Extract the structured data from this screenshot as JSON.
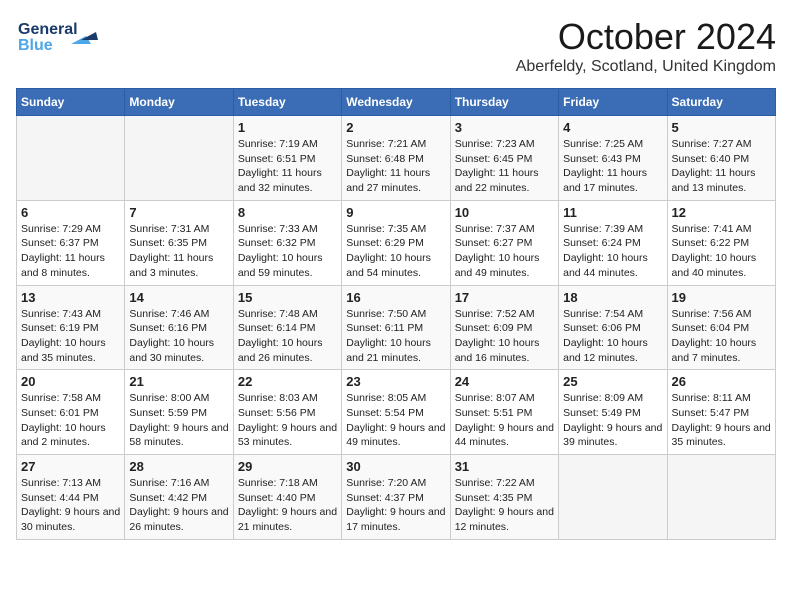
{
  "logo": {
    "line1": "General",
    "line2": "Blue"
  },
  "title": {
    "month": "October 2024",
    "location": "Aberfeldy, Scotland, United Kingdom"
  },
  "headers": [
    "Sunday",
    "Monday",
    "Tuesday",
    "Wednesday",
    "Thursday",
    "Friday",
    "Saturday"
  ],
  "weeks": [
    [
      {
        "day": "",
        "info": ""
      },
      {
        "day": "",
        "info": ""
      },
      {
        "day": "1",
        "info": "Sunrise: 7:19 AM\nSunset: 6:51 PM\nDaylight: 11 hours and 32 minutes."
      },
      {
        "day": "2",
        "info": "Sunrise: 7:21 AM\nSunset: 6:48 PM\nDaylight: 11 hours and 27 minutes."
      },
      {
        "day": "3",
        "info": "Sunrise: 7:23 AM\nSunset: 6:45 PM\nDaylight: 11 hours and 22 minutes."
      },
      {
        "day": "4",
        "info": "Sunrise: 7:25 AM\nSunset: 6:43 PM\nDaylight: 11 hours and 17 minutes."
      },
      {
        "day": "5",
        "info": "Sunrise: 7:27 AM\nSunset: 6:40 PM\nDaylight: 11 hours and 13 minutes."
      }
    ],
    [
      {
        "day": "6",
        "info": "Sunrise: 7:29 AM\nSunset: 6:37 PM\nDaylight: 11 hours and 8 minutes."
      },
      {
        "day": "7",
        "info": "Sunrise: 7:31 AM\nSunset: 6:35 PM\nDaylight: 11 hours and 3 minutes."
      },
      {
        "day": "8",
        "info": "Sunrise: 7:33 AM\nSunset: 6:32 PM\nDaylight: 10 hours and 59 minutes."
      },
      {
        "day": "9",
        "info": "Sunrise: 7:35 AM\nSunset: 6:29 PM\nDaylight: 10 hours and 54 minutes."
      },
      {
        "day": "10",
        "info": "Sunrise: 7:37 AM\nSunset: 6:27 PM\nDaylight: 10 hours and 49 minutes."
      },
      {
        "day": "11",
        "info": "Sunrise: 7:39 AM\nSunset: 6:24 PM\nDaylight: 10 hours and 44 minutes."
      },
      {
        "day": "12",
        "info": "Sunrise: 7:41 AM\nSunset: 6:22 PM\nDaylight: 10 hours and 40 minutes."
      }
    ],
    [
      {
        "day": "13",
        "info": "Sunrise: 7:43 AM\nSunset: 6:19 PM\nDaylight: 10 hours and 35 minutes."
      },
      {
        "day": "14",
        "info": "Sunrise: 7:46 AM\nSunset: 6:16 PM\nDaylight: 10 hours and 30 minutes."
      },
      {
        "day": "15",
        "info": "Sunrise: 7:48 AM\nSunset: 6:14 PM\nDaylight: 10 hours and 26 minutes."
      },
      {
        "day": "16",
        "info": "Sunrise: 7:50 AM\nSunset: 6:11 PM\nDaylight: 10 hours and 21 minutes."
      },
      {
        "day": "17",
        "info": "Sunrise: 7:52 AM\nSunset: 6:09 PM\nDaylight: 10 hours and 16 minutes."
      },
      {
        "day": "18",
        "info": "Sunrise: 7:54 AM\nSunset: 6:06 PM\nDaylight: 10 hours and 12 minutes."
      },
      {
        "day": "19",
        "info": "Sunrise: 7:56 AM\nSunset: 6:04 PM\nDaylight: 10 hours and 7 minutes."
      }
    ],
    [
      {
        "day": "20",
        "info": "Sunrise: 7:58 AM\nSunset: 6:01 PM\nDaylight: 10 hours and 2 minutes."
      },
      {
        "day": "21",
        "info": "Sunrise: 8:00 AM\nSunset: 5:59 PM\nDaylight: 9 hours and 58 minutes."
      },
      {
        "day": "22",
        "info": "Sunrise: 8:03 AM\nSunset: 5:56 PM\nDaylight: 9 hours and 53 minutes."
      },
      {
        "day": "23",
        "info": "Sunrise: 8:05 AM\nSunset: 5:54 PM\nDaylight: 9 hours and 49 minutes."
      },
      {
        "day": "24",
        "info": "Sunrise: 8:07 AM\nSunset: 5:51 PM\nDaylight: 9 hours and 44 minutes."
      },
      {
        "day": "25",
        "info": "Sunrise: 8:09 AM\nSunset: 5:49 PM\nDaylight: 9 hours and 39 minutes."
      },
      {
        "day": "26",
        "info": "Sunrise: 8:11 AM\nSunset: 5:47 PM\nDaylight: 9 hours and 35 minutes."
      }
    ],
    [
      {
        "day": "27",
        "info": "Sunrise: 7:13 AM\nSunset: 4:44 PM\nDaylight: 9 hours and 30 minutes."
      },
      {
        "day": "28",
        "info": "Sunrise: 7:16 AM\nSunset: 4:42 PM\nDaylight: 9 hours and 26 minutes."
      },
      {
        "day": "29",
        "info": "Sunrise: 7:18 AM\nSunset: 4:40 PM\nDaylight: 9 hours and 21 minutes."
      },
      {
        "day": "30",
        "info": "Sunrise: 7:20 AM\nSunset: 4:37 PM\nDaylight: 9 hours and 17 minutes."
      },
      {
        "day": "31",
        "info": "Sunrise: 7:22 AM\nSunset: 4:35 PM\nDaylight: 9 hours and 12 minutes."
      },
      {
        "day": "",
        "info": ""
      },
      {
        "day": "",
        "info": ""
      }
    ]
  ]
}
